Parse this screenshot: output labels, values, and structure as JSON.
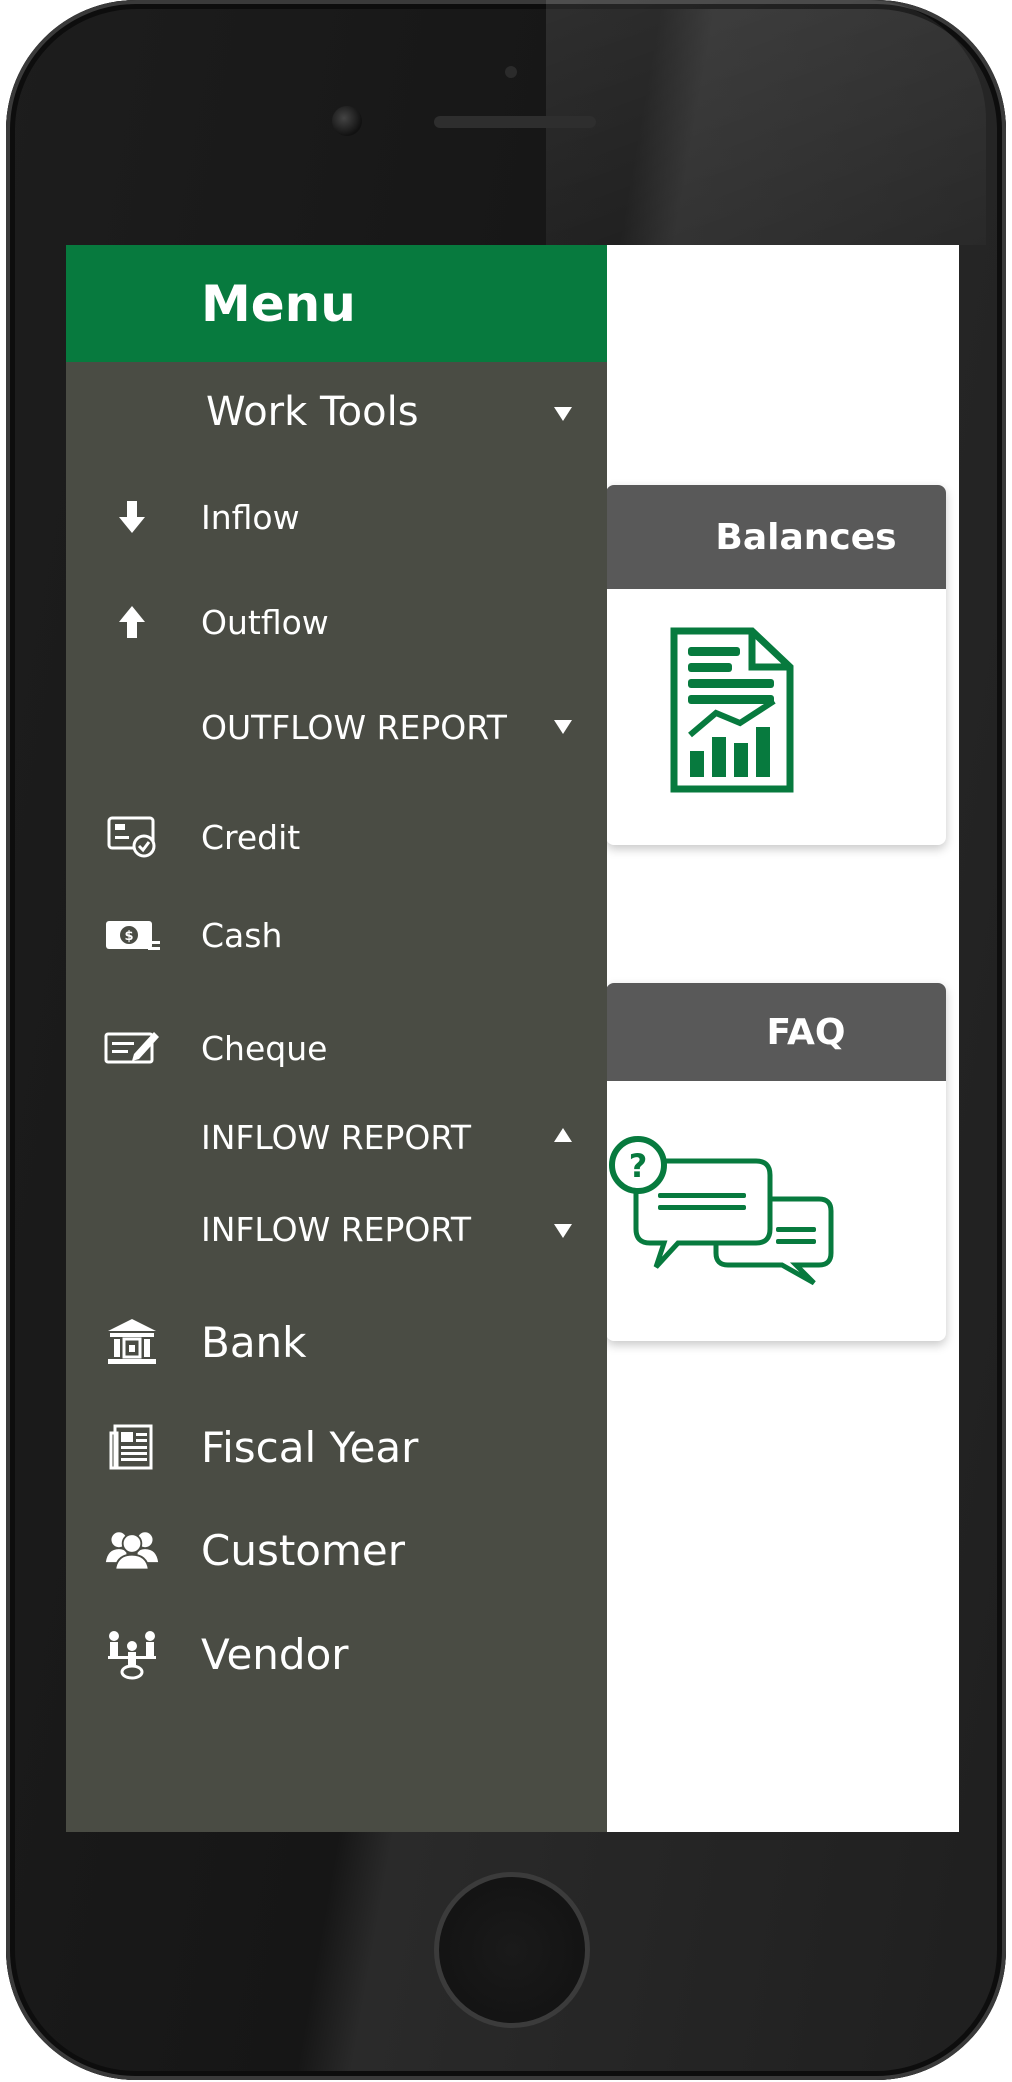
{
  "drawer": {
    "title": "Menu",
    "items": [
      {
        "label": "Work Tools",
        "icon": "none",
        "caret": "down"
      },
      {
        "label": "Inflow",
        "icon": "arrow-down-icon"
      },
      {
        "label": "Outflow",
        "icon": "arrow-up-icon"
      },
      {
        "label": "OUTFLOW REPORT",
        "icon": "none",
        "caret": "down"
      },
      {
        "label": "Credit",
        "icon": "credit-card-icon"
      },
      {
        "label": "Cash",
        "icon": "cash-icon"
      },
      {
        "label": "Cheque",
        "icon": "cheque-icon"
      },
      {
        "label": "INFLOW REPORT",
        "icon": "none",
        "caret": "up"
      },
      {
        "label": "INFLOW REPORT",
        "icon": "none",
        "caret": "down"
      },
      {
        "label": "Bank",
        "icon": "bank-icon"
      },
      {
        "label": "Fiscal Year",
        "icon": "fiscal-year-icon"
      },
      {
        "label": "Customer",
        "icon": "customer-icon"
      },
      {
        "label": "Vendor",
        "icon": "vendor-icon"
      }
    ]
  },
  "cards": {
    "balances": {
      "title": "Balances",
      "icon": "report-chart-icon"
    },
    "faq": {
      "title": "FAQ",
      "icon": "faq-chat-icon"
    }
  },
  "colors": {
    "brand_green": "#077a3e",
    "drawer_bg": "#4a4c44",
    "card_header": "#595959"
  }
}
